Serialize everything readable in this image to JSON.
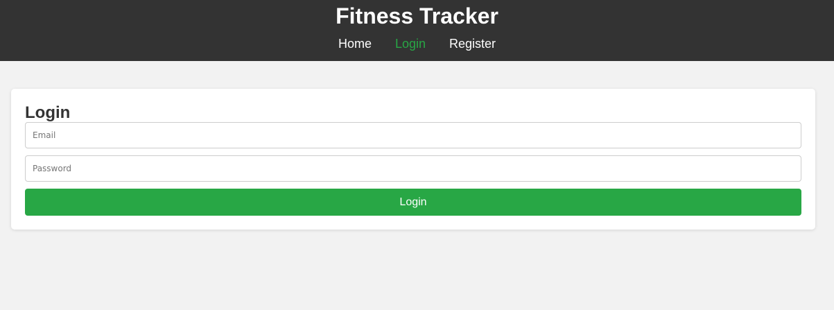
{
  "header": {
    "title": "Fitness Tracker",
    "nav": [
      {
        "label": "Home",
        "active": false
      },
      {
        "label": "Login",
        "active": true
      },
      {
        "label": "Register",
        "active": false
      }
    ]
  },
  "login": {
    "title": "Login",
    "email": {
      "placeholder": "Email",
      "value": ""
    },
    "password": {
      "placeholder": "Password",
      "value": ""
    },
    "submit_label": "Login"
  },
  "colors": {
    "header_bg": "#333333",
    "accent": "#28a745",
    "page_bg": "#f2f2f2"
  }
}
